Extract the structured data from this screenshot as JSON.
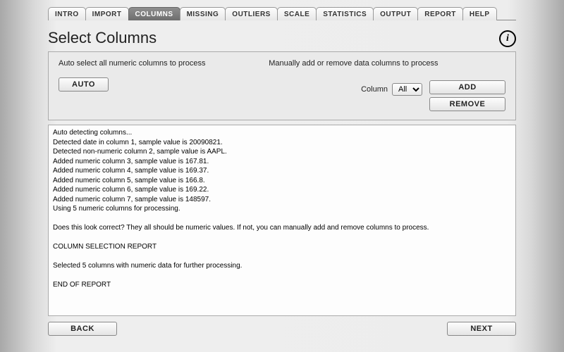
{
  "tabs": [
    {
      "label": "INTRO",
      "active": false
    },
    {
      "label": "IMPORT",
      "active": false
    },
    {
      "label": "COLUMNS",
      "active": true
    },
    {
      "label": "MISSING",
      "active": false
    },
    {
      "label": "OUTLIERS",
      "active": false
    },
    {
      "label": "SCALE",
      "active": false
    },
    {
      "label": "STATISTICS",
      "active": false
    },
    {
      "label": "OUTPUT",
      "active": false
    },
    {
      "label": "REPORT",
      "active": false
    },
    {
      "label": "HELP",
      "active": false
    }
  ],
  "page": {
    "title": "Select Columns",
    "info_glyph": "i"
  },
  "options": {
    "auto_caption": "Auto select all numeric columns to process",
    "auto_button": "AUTO",
    "manual_caption": "Manually add or remove data columns to process",
    "column_label": "Column",
    "column_select_value": "All",
    "add_button": "ADD",
    "remove_button": "REMOVE"
  },
  "log_lines": [
    "Auto detecting columns...",
    "Detected date in column 1, sample value is 20090821.",
    "Detected non-numeric column 2, sample value is AAPL.",
    "Added numeric column 3, sample value is 167.81.",
    "Added numeric column 4, sample value is 169.37.",
    "Added numeric column 5, sample value is 166.8.",
    "Added numeric column 6, sample value is 169.22.",
    "Added numeric column 7, sample value is 148597.",
    "Using 5 numeric columns for processing.",
    "",
    "Does this look correct? They all should be numeric values. If not, you can manually add and remove columns to process.",
    "",
    "COLUMN SELECTION REPORT",
    "",
    "Selected 5 columns with numeric data for further processing.",
    "",
    "END OF REPORT"
  ],
  "footer": {
    "back": "BACK",
    "next": "NEXT"
  }
}
